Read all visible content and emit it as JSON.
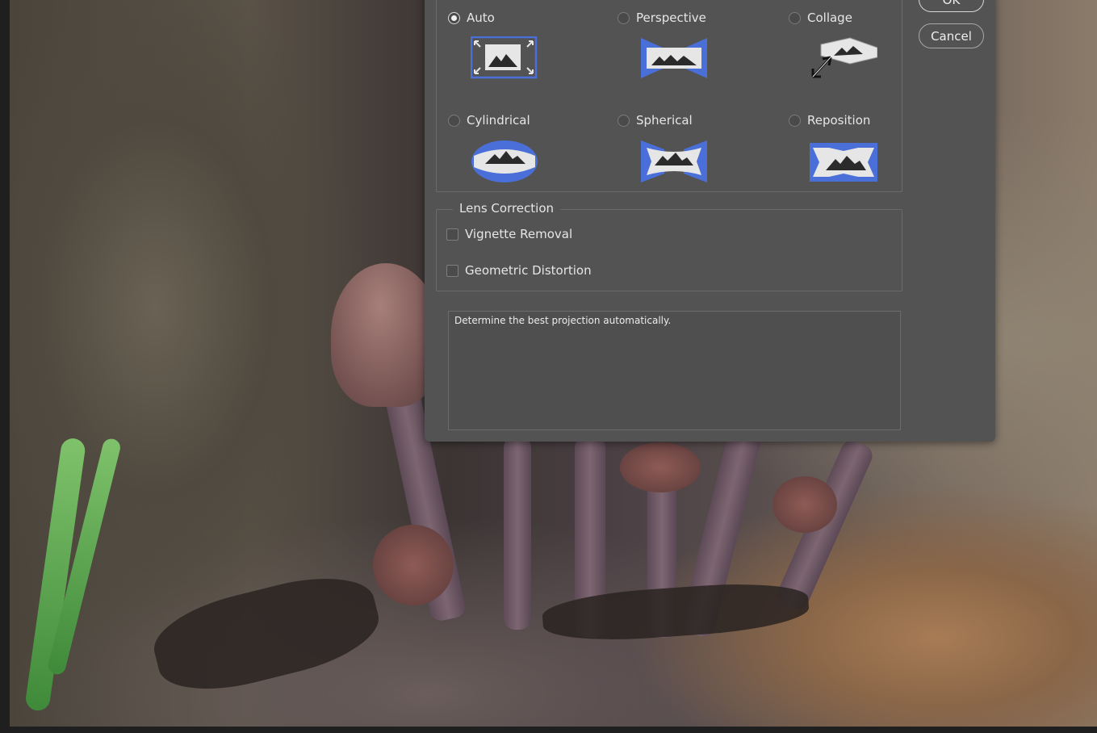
{
  "layout": {
    "options": [
      {
        "label": "Auto",
        "selected": true,
        "icon": "auto-layout-icon"
      },
      {
        "label": "Perspective",
        "selected": false,
        "icon": "perspective-layout-icon"
      },
      {
        "label": "Collage",
        "selected": false,
        "icon": "collage-layout-icon"
      },
      {
        "label": "Cylindrical",
        "selected": false,
        "icon": "cylindrical-layout-icon"
      },
      {
        "label": "Spherical",
        "selected": false,
        "icon": "spherical-layout-icon"
      },
      {
        "label": "Reposition",
        "selected": false,
        "icon": "reposition-layout-icon"
      }
    ]
  },
  "lens_correction": {
    "title": "Lens Correction",
    "vignette_removal": {
      "label": "Vignette Removal",
      "checked": false
    },
    "geometric_distortion": {
      "label": "Geometric Distortion",
      "checked": false
    }
  },
  "description": "Determine the best projection automatically.",
  "buttons": {
    "ok": "OK",
    "cancel": "Cancel"
  },
  "colors": {
    "dialog_bg": "#535353",
    "icon_accent": "#4a6fd8",
    "icon_fill": "#e6e6e6"
  }
}
